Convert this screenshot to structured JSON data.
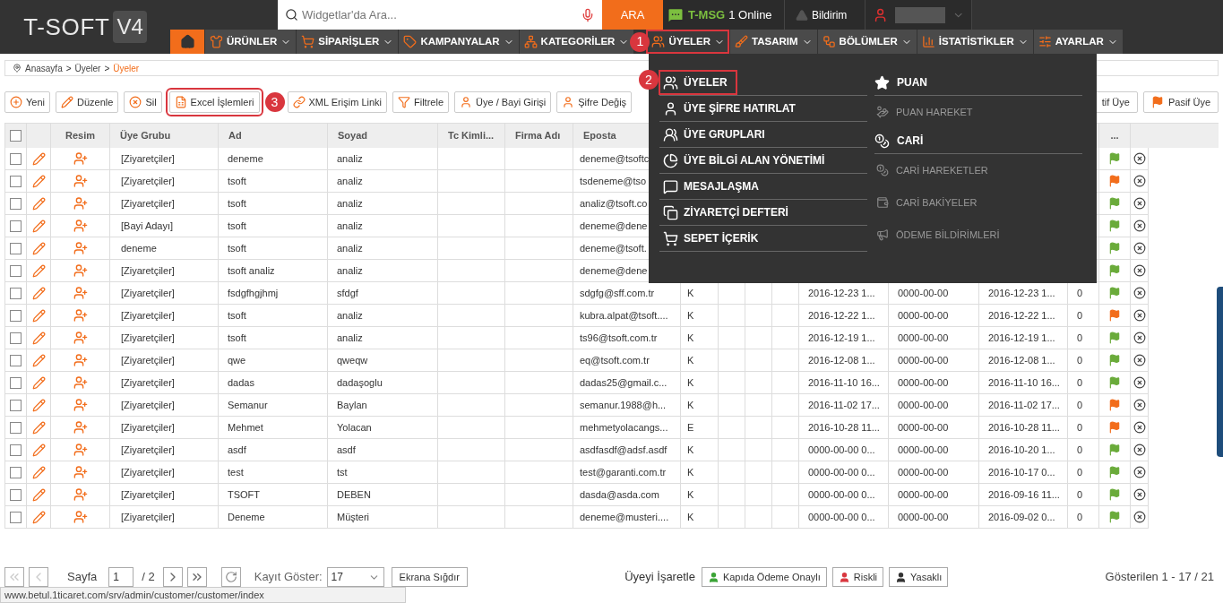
{
  "header": {
    "logo": "T-SOFT",
    "logo_badge": "V4",
    "search": {
      "placeholder": "Widgetlar'da Ara..."
    },
    "search_button": "ARA",
    "msg_brand": "T-MSG",
    "msg_status": "1 Online",
    "notifications": "Bildirim"
  },
  "nav": [
    {
      "label": "ÜRÜNLER",
      "selected": false
    },
    {
      "label": "SİPARİŞLER",
      "selected": false
    },
    {
      "label": "KAMPANYALAR",
      "selected": false
    },
    {
      "label": "KATEGORİLER",
      "selected": false
    },
    {
      "label": "ÜYELER",
      "selected": true,
      "callout": "1"
    },
    {
      "label": "TASARIM",
      "selected": false
    },
    {
      "label": "BÖLÜMLER",
      "selected": false
    },
    {
      "label": "İSTATİSTİKLER",
      "selected": false
    },
    {
      "label": "AYARLAR",
      "selected": false
    }
  ],
  "menu": {
    "left": [
      {
        "label": "ÜYELER",
        "callout": "2"
      },
      {
        "label": "ÜYE ŞİFRE HATIRLAT"
      },
      {
        "label": "ÜYE GRUPLARI"
      },
      {
        "label": "ÜYE BİLGİ ALAN YÖNETİMİ"
      },
      {
        "label": "MESAJLAŞMA"
      },
      {
        "label": "ZİYARETÇİ DEFTERİ"
      },
      {
        "label": "SEPET İÇERİK"
      }
    ],
    "right": [
      {
        "label": "PUAN",
        "kind": "header"
      },
      {
        "label": "PUAN HAREKET",
        "kind": "sub"
      },
      {
        "label": "CARİ",
        "kind": "header"
      },
      {
        "label": "CARİ HAREKETLER",
        "kind": "sub"
      },
      {
        "label": "CARİ BAKİYELER",
        "kind": "sub"
      },
      {
        "label": "ÖDEME BİLDİRİMLERİ",
        "kind": "sub"
      }
    ]
  },
  "breadcrumb": {
    "items": [
      "Anasayfa",
      "Üyeler",
      "Üyeler"
    ],
    "separator": ">"
  },
  "toolbar": [
    {
      "label": "Yeni"
    },
    {
      "label": "Düzenle"
    },
    {
      "label": "Sil"
    },
    {
      "label": "Excel İşlemleri",
      "callout": "3"
    },
    {
      "label": "XML Erişim Linki"
    },
    {
      "label": "Filtrele"
    },
    {
      "label": "Üye / Bayi Girişi"
    },
    {
      "label": "Şifre Değiş"
    }
  ],
  "toolbar_right": [
    {
      "label": "tif Üye"
    },
    {
      "label": "Pasif Üye"
    }
  ],
  "table": {
    "all_checked": false,
    "columns": [
      "Resim",
      "Üye Grubu",
      "Ad",
      "Soyad",
      "Tc Kimli...",
      "Firma Adı",
      "Eposta"
    ],
    "more_column": "...",
    "rows": [
      {
        "checked": false,
        "group": "[Ziyaretçiler]",
        "first_name": "deneme",
        "last_name": "analiz",
        "email": "deneme@tsoftc",
        "color": "#6aab3a"
      },
      {
        "checked": false,
        "group": "[Ziyaretçiler]",
        "first_name": "tsoft",
        "last_name": "analiz",
        "email": "tsdeneme@tso",
        "color": "#f26d1b"
      },
      {
        "checked": false,
        "group": "[Ziyaretçiler]",
        "first_name": "tsoft",
        "last_name": "analiz",
        "email": "analiz@tsoft.co",
        "color": "#6aab3a"
      },
      {
        "checked": false,
        "group": "[Bayi Adayı]",
        "first_name": "tsoft",
        "last_name": "analiz",
        "email": "deneme@dene",
        "color": "#6aab3a"
      },
      {
        "checked": false,
        "group": "deneme",
        "first_name": "tsoft",
        "last_name": "analiz",
        "email": "deneme@tsoft.",
        "color": "#6aab3a"
      },
      {
        "checked": false,
        "group": "[Ziyaretçiler]",
        "first_name": "tsoft analiz",
        "last_name": "analiz",
        "email": "deneme@dene",
        "color": "#6aab3a"
      },
      {
        "checked": false,
        "group": "[Ziyaretçiler]",
        "first_name": "fsdgfhgjhmj",
        "last_name": "sfdgf",
        "email": "sdgfg@sff.com.tr",
        "extra": [
          "K",
          "2016-12-23 1...",
          "0000-00-00",
          "2016-12-23 1...",
          "0"
        ],
        "color": "#6aab3a"
      },
      {
        "checked": false,
        "group": "[Ziyaretçiler]",
        "first_name": "tsoft",
        "last_name": "analiz",
        "email": "kubra.alpat@tsoft....",
        "extra": [
          "K",
          "2016-12-22 1...",
          "0000-00-00",
          "2016-12-22 1...",
          "0"
        ],
        "color": "#f26d1b"
      },
      {
        "checked": false,
        "group": "[Ziyaretçiler]",
        "first_name": "tsoft",
        "last_name": "analiz",
        "email": "ts96@tsoft.com.tr",
        "extra": [
          "K",
          "2016-12-19 1...",
          "0000-00-00",
          "2016-12-19 1...",
          "0"
        ],
        "color": "#6aab3a"
      },
      {
        "checked": false,
        "group": "[Ziyaretçiler]",
        "first_name": "qwe",
        "last_name": "qweqw",
        "email": "eq@tsoft.com.tr",
        "extra": [
          "K",
          "2016-12-08 1...",
          "0000-00-00",
          "2016-12-08 1...",
          "0"
        ],
        "color": "#6aab3a"
      },
      {
        "checked": false,
        "group": "[Ziyaretçiler]",
        "first_name": "dadas",
        "last_name": "dadaşoglu",
        "email": "dadas25@gmail.c...",
        "extra": [
          "K",
          "2016-11-10 16...",
          "0000-00-00",
          "2016-11-10 16...",
          "0"
        ],
        "color": "#6aab3a"
      },
      {
        "checked": false,
        "group": "[Ziyaretçiler]",
        "first_name": "Semanur",
        "last_name": "Baylan",
        "email": "semanur.1988@h...",
        "extra": [
          "K",
          "2016-11-02 17...",
          "0000-00-00",
          "2016-11-02 17...",
          "0"
        ],
        "color": "#f26d1b"
      },
      {
        "checked": false,
        "group": "[Ziyaretçiler]",
        "first_name": "Mehmet",
        "last_name": "Yolacan",
        "email": "mehmetyolacangs...",
        "extra": [
          "E",
          "2016-10-28 11...",
          "0000-00-00",
          "2016-10-28 11...",
          "0"
        ],
        "color": "#f26d1b"
      },
      {
        "checked": false,
        "group": "[Ziyaretçiler]",
        "first_name": "asdf",
        "last_name": "asdf",
        "email": "asdfasdf@adsf.asdf",
        "extra": [
          "K",
          "0000-00-00 0...",
          "0000-00-00",
          "2016-10-20 1...",
          "0"
        ],
        "color": "#6aab3a"
      },
      {
        "checked": false,
        "group": "[Ziyaretçiler]",
        "first_name": "test",
        "last_name": "tst",
        "email": "test@garanti.com.tr",
        "extra": [
          "K",
          "0000-00-00 0...",
          "0000-00-00",
          "2016-10-17 0...",
          "0"
        ],
        "color": "#6aab3a"
      },
      {
        "checked": false,
        "group": "[Ziyaretçiler]",
        "first_name": "TSOFT",
        "last_name": "DEBEN",
        "email": "dasda@asda.com",
        "extra": [
          "K",
          "0000-00-00 0...",
          "0000-00-00",
          "2016-09-16 11...",
          "0"
        ],
        "color": "#6aab3a"
      },
      {
        "checked": false,
        "group": "[Ziyaretçiler]",
        "first_name": "Deneme",
        "last_name": "Müşteri",
        "email": "deneme@musteri....",
        "extra": [
          "K",
          "0000-00-00 0...",
          "0000-00-00",
          "2016-09-02 0...",
          "0"
        ],
        "color": "#6aab3a"
      }
    ]
  },
  "footer": {
    "page_label": "Sayfa",
    "page": "1",
    "page_total": "/ 2",
    "page_size_label": "Kayıt Göster:",
    "page_size": "17",
    "fit_button": "Ekrana Sığdır",
    "mark_label": "Üyeyi İşaretle",
    "mark_buttons": [
      {
        "label": "Kapıda Ödeme Onaylı",
        "color": "#3aa335"
      },
      {
        "label": "Riskli",
        "color": "#d9363e"
      },
      {
        "label": "Yasaklı",
        "color": "#333333"
      }
    ],
    "summary": "Gösterilen 1 - 17 / 21"
  },
  "status_url": "www.betul.1ticaret.com/srv/admin/customer/customer/index"
}
